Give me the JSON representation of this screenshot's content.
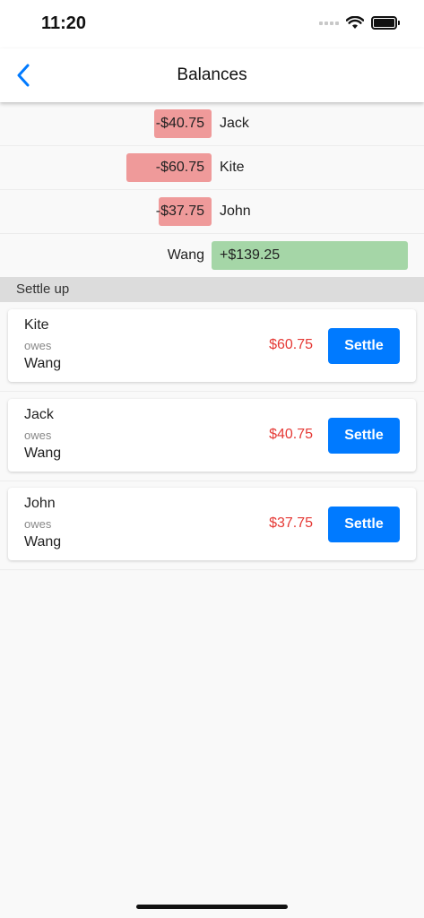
{
  "status_bar": {
    "time": "11:20"
  },
  "nav": {
    "title": "Balances",
    "back_icon": "chevron-left-icon"
  },
  "balances": [
    {
      "name": "Jack",
      "amount": "-$40.75",
      "value": -40.75
    },
    {
      "name": "Kite",
      "amount": "-$60.75",
      "value": -60.75
    },
    {
      "name": "John",
      "amount": "-$37.75",
      "value": -37.75
    },
    {
      "name": "Wang",
      "amount": "+$139.25",
      "value": 139.25
    }
  ],
  "settle_section": {
    "header": "Settle up",
    "items": [
      {
        "from": "Kite",
        "owes_label": "owes",
        "to": "Wang",
        "amount": "$60.75",
        "button_label": "Settle"
      },
      {
        "from": "Jack",
        "owes_label": "owes",
        "to": "Wang",
        "amount": "$40.75",
        "button_label": "Settle"
      },
      {
        "from": "John",
        "owes_label": "owes",
        "to": "Wang",
        "amount": "$37.75",
        "button_label": "Settle"
      }
    ]
  },
  "colors": {
    "accent": "#007aff",
    "negative_bar": "#ef9a9a",
    "positive_bar": "#a5d6a7",
    "owed_amount": "#e53935"
  }
}
